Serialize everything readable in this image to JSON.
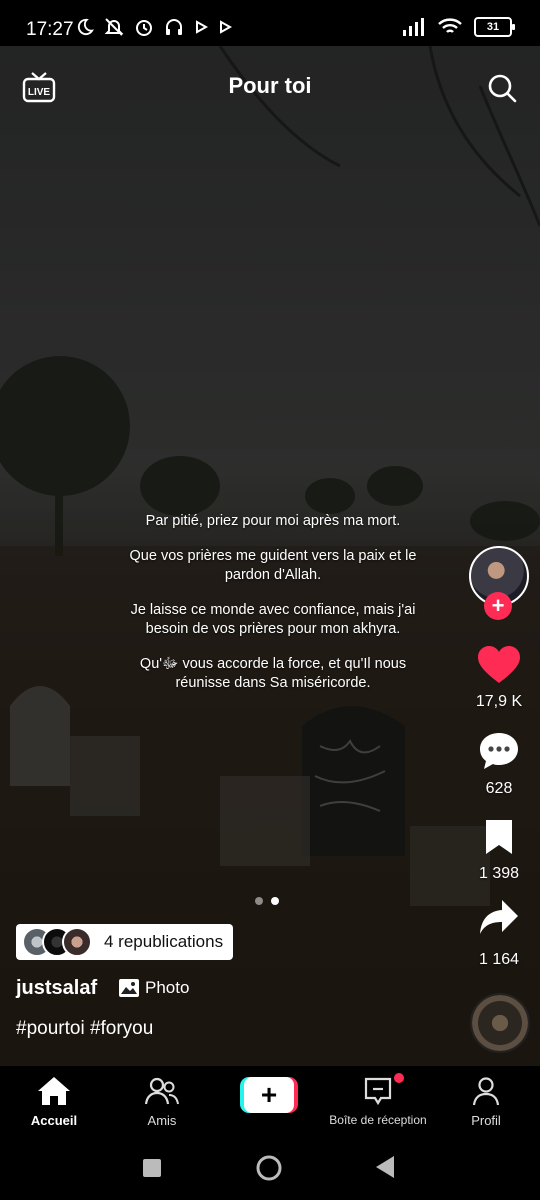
{
  "status_bar": {
    "time": "17:27",
    "battery": "31"
  },
  "header": {
    "title": "Pour toi"
  },
  "post": {
    "caption": [
      "Par pitié, priez pour moi après ma mort.",
      "Que vos prières me guident vers la paix et le pardon d'Allah.",
      "Je laisse ce monde avec confiance, mais j'ai besoin de vos prières pour mon akhyra.",
      "Qu'ﷻ vous accorde la force, et qu'Il nous réunisse dans Sa miséricorde."
    ],
    "likes": "17,9 K",
    "comments": "628",
    "saves": "1 398",
    "shares": "1 164",
    "republications": "4 republications",
    "username": "justsalaf",
    "type_label": "Photo",
    "hashtags": "#pourtoi #foryou",
    "page_index": 2,
    "page_count": 2
  },
  "bottom_nav": {
    "items": [
      {
        "label": "Accueil",
        "icon": "home-icon"
      },
      {
        "label": "Amis",
        "icon": "friends-icon"
      },
      {
        "label": "Boîte de réception",
        "icon": "inbox-icon"
      },
      {
        "label": "Profil",
        "icon": "profile-icon"
      }
    ]
  },
  "colors": {
    "accent": "#fe2c55",
    "secondary_accent": "#25f4ee",
    "like": "#fe2c55"
  }
}
